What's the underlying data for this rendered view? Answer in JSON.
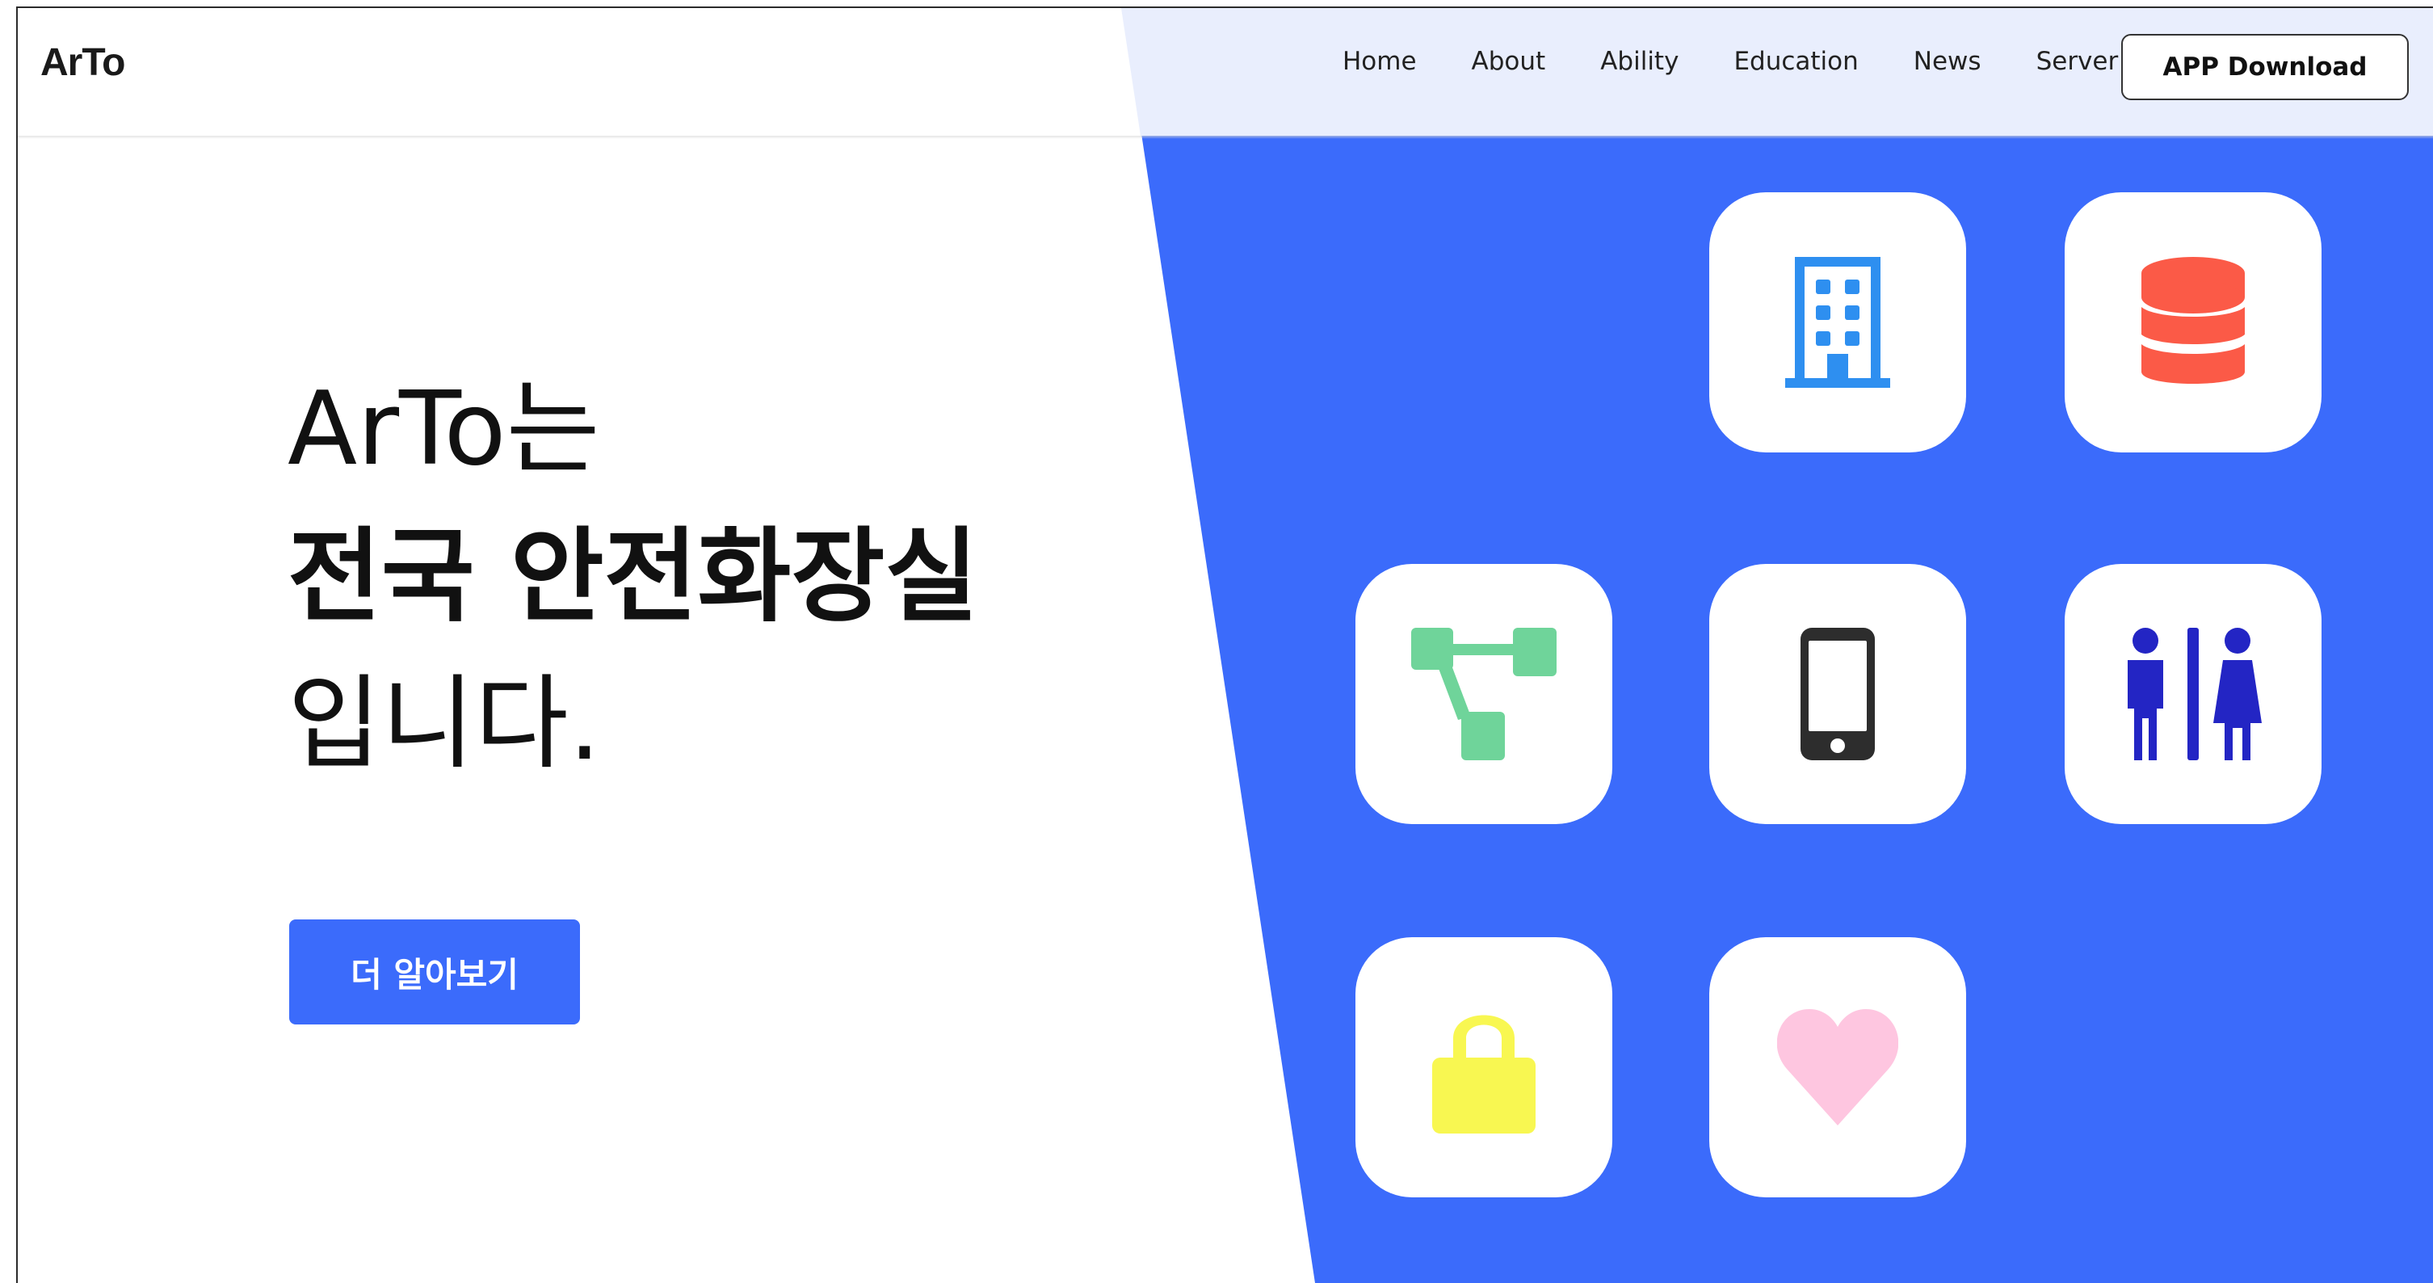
{
  "header": {
    "logo": "ArTo",
    "nav": [
      "Home",
      "About",
      "Ability",
      "Education",
      "News",
      "Server"
    ],
    "app_button_label": "APP Download"
  },
  "hero": {
    "line1": "ArTo는",
    "line2": "전국 안전화장실",
    "line3": "입니다.",
    "cta_label": "더 알아보기"
  },
  "icons": [
    {
      "name": "building-icon",
      "color": "#2e8ff0"
    },
    {
      "name": "database-icon",
      "color": "#fb5a47"
    },
    {
      "name": "network-icon",
      "color": "#6fd49a"
    },
    {
      "name": "smartphone-icon",
      "color": "#2d2d2d"
    },
    {
      "name": "restroom-icon",
      "color": "#2325c4"
    },
    {
      "name": "lock-icon",
      "color": "#f8f751"
    },
    {
      "name": "heart-icon",
      "color": "#fec6e0"
    }
  ],
  "colors": {
    "accent": "#3b6bfb",
    "header_tint": "#e9eefd"
  }
}
